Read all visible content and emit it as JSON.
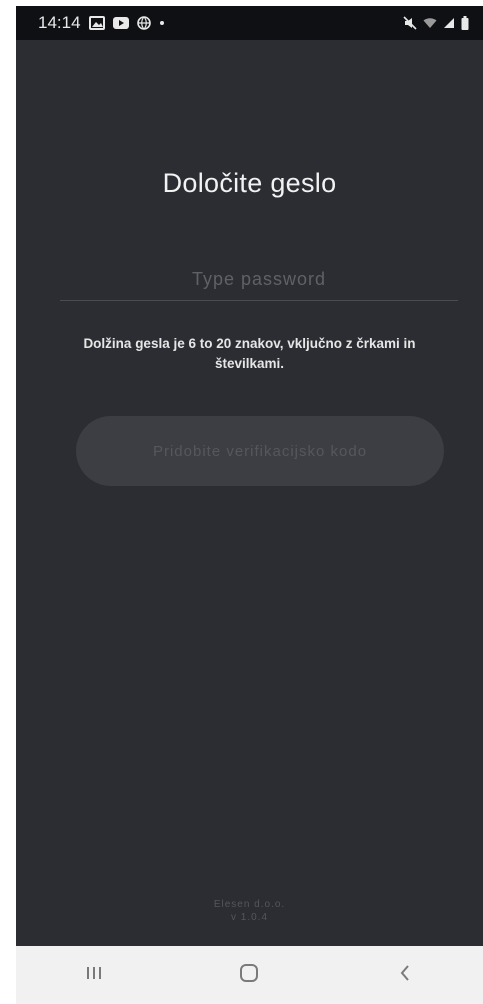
{
  "status_bar": {
    "time": "14:14",
    "left_icons": [
      "gallery-icon",
      "youtube-icon",
      "globe-icon",
      "dot-icon"
    ],
    "right_icons": [
      "mute-icon",
      "wifi-icon",
      "signal-icon",
      "battery-icon"
    ]
  },
  "screen": {
    "title": "Določite geslo",
    "password_placeholder": "Type password",
    "password_value": "",
    "hint_line1": "Dolžina gesla je 6 to 20 znakov, vključno z črkami in",
    "hint_line2": "številkami.",
    "verify_button_label": "Pridobite verifikacijsko kodo",
    "footer_company": "Elesen d.o.o.",
    "footer_version": "v 1.0.4"
  },
  "nav_bar": {
    "buttons": [
      "recent-apps-icon",
      "home-icon",
      "back-icon"
    ]
  },
  "colors": {
    "background": "#2b2d32",
    "status_bar": "#0f1013",
    "button_disabled": "#3c3e44",
    "nav_bar": "#f1f1f1"
  }
}
